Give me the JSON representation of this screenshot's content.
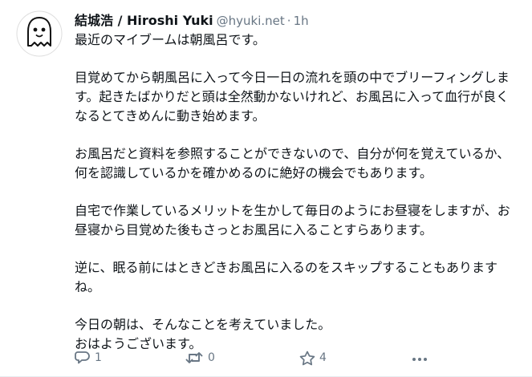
{
  "post": {
    "display_name": "結城浩 / Hiroshi Yuki",
    "handle": "@hyuki.net",
    "separator": "·",
    "time": "1h",
    "paragraphs": [
      "最近のマイブームは朝風呂です。",
      "目覚めてから朝風呂に入って今日一日の流れを頭の中でブリーフィングします。起きたばかりだと頭は全然動かないけれど、お風呂に入って血行が良くなるとてきめんに動き始めます。",
      "お風呂だと資料を参照することができないので、自分が何を覚えているか、何を認識しているかを確かめるのに絶好の機会でもあります。",
      "自宅で作業しているメリットを生かして毎日のようにお昼寝をしますが、お昼寝から目覚めた後もさっとお風呂に入ることすらあります。",
      "逆に、眠る前にはときどきお風呂に入るのをスキップすることもありますね。",
      "今日の朝は、そんなことを考えていました。\nおはようございます。"
    ],
    "actions": {
      "reply_count": "1",
      "boost_count": "0",
      "favourite_count": "4"
    }
  },
  "icons": {
    "avatar": "ghost-avatar",
    "reply": "reply-icon",
    "boost": "boost-icon",
    "favourite": "star-icon",
    "more": "more-icon"
  },
  "colors": {
    "text": "#0f1419",
    "muted": "#687684"
  }
}
